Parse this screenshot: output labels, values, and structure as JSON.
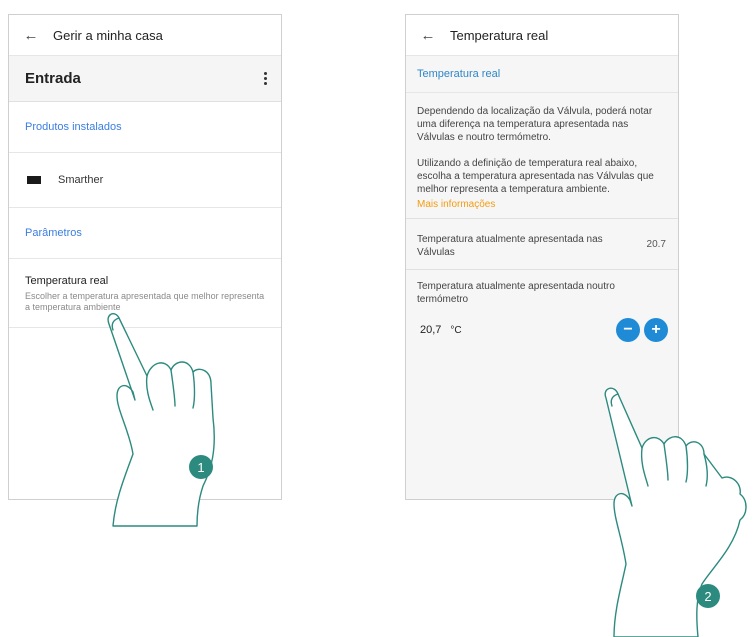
{
  "screen1": {
    "title": "Gerir a minha casa",
    "room": "Entrada",
    "products_section": "Produtos instalados",
    "product_name": "Smarther",
    "params_section": "Parâmetros",
    "param_name": "Temperatura real",
    "param_desc": "Escolher a temperatura apresentada que melhor representa a temperatura ambiente"
  },
  "screen2": {
    "title": "Temperatura real",
    "header_link": "Temperatura real",
    "paragraph1": "Dependendo da localização da Válvula, poderá notar uma diferença na temperatura apresentada nas Válvulas e noutro termómetro.",
    "paragraph2": "Utilizando a definição de temperatura real abaixo, escolha a temperatura apresentada nas Válvulas que melhor representa a temperatura ambiente.",
    "more_info": "Mais informações",
    "valves_label": "Temperatura atualmente apresentada nas Válvulas",
    "valves_value": "20.7",
    "other_label": "Temperatura atualmente apresentada noutro termómetro",
    "other_value": "20,7",
    "unit": "°C",
    "minus": "−",
    "plus": "+"
  },
  "steps": {
    "step1": "1",
    "step2": "2"
  },
  "colors": {
    "link_blue": "#3b7ee0",
    "accent_orange": "#f39c12",
    "button_blue": "#1f8bd6",
    "badge_teal": "#2c8a7f"
  }
}
